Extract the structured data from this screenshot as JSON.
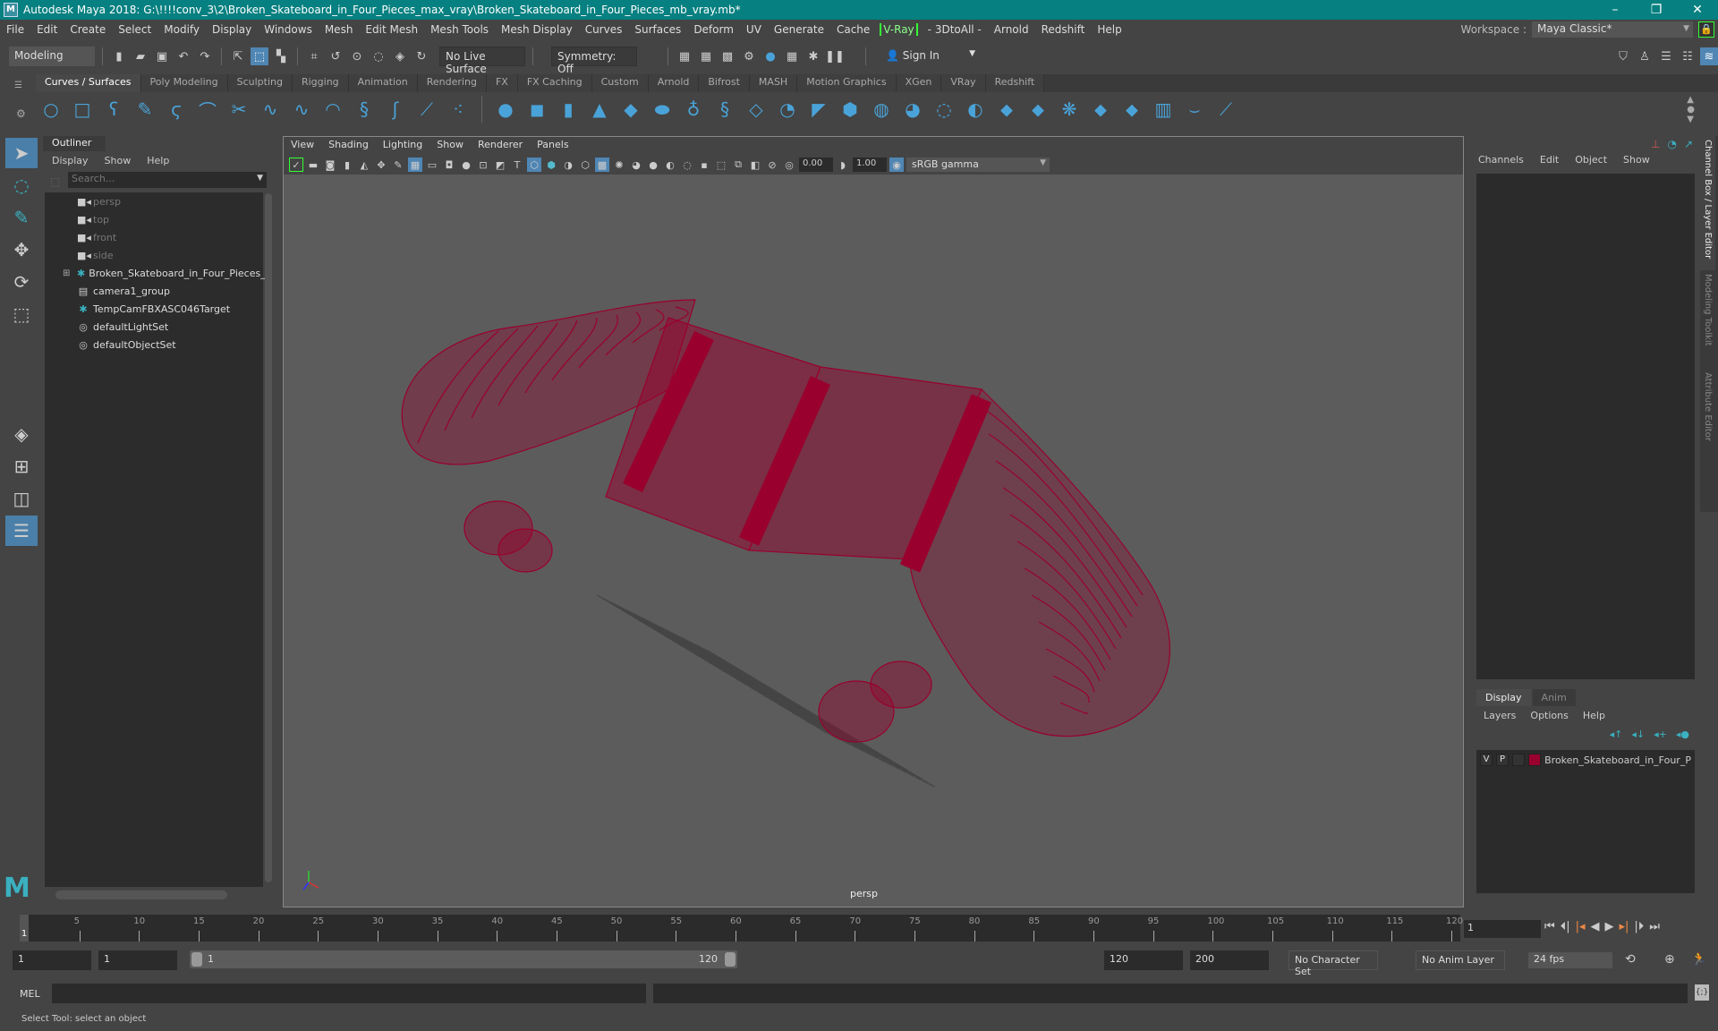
{
  "window": {
    "title": "Autodesk Maya 2018: G:\\!!!!conv_3\\2\\Broken_Skateboard_in_Four_Pieces_max_vray\\Broken_Skateboard_in_Four_Pieces_mb_vray.mb*",
    "controls": [
      "–",
      "❐",
      "✕"
    ]
  },
  "menubar": [
    "File",
    "Edit",
    "Create",
    "Select",
    "Modify",
    "Display",
    "Windows",
    "Mesh",
    "Edit Mesh",
    "Mesh Tools",
    "Mesh Display",
    "Curves",
    "Surfaces",
    "Deform",
    "UV",
    "Generate",
    "Cache",
    "V-Ray",
    "- 3DtoAll -",
    "Arnold",
    "Redshift",
    "Help"
  ],
  "workspace": {
    "label": "Workspace :",
    "value": "Maya Classic*"
  },
  "statusline": {
    "mode": "Modeling",
    "live_surface": "No Live Surface",
    "symmetry": "Symmetry: Off",
    "sign_in": "Sign In"
  },
  "shelf": {
    "tabs": [
      "Curves / Surfaces",
      "Poly Modeling",
      "Sculpting",
      "Rigging",
      "Animation",
      "Rendering",
      "FX",
      "FX Caching",
      "Custom",
      "Arnold",
      "Bifrost",
      "MASH",
      "Motion Graphics",
      "XGen",
      "VRay",
      "Redshift"
    ],
    "active_tab": 0
  },
  "outliner": {
    "title": "Outliner",
    "menu": [
      "Display",
      "Show",
      "Help"
    ],
    "search_placeholder": "Search...",
    "items": [
      {
        "label": "persp",
        "icon": "camera-icon",
        "dim": true
      },
      {
        "label": "top",
        "icon": "camera-icon",
        "dim": true
      },
      {
        "label": "front",
        "icon": "camera-icon",
        "dim": true
      },
      {
        "label": "side",
        "icon": "camera-icon",
        "dim": true
      },
      {
        "label": "Broken_Skateboard_in_Four_Pieces_r",
        "icon": "transform-icon",
        "expandable": true
      },
      {
        "label": "camera1_group",
        "icon": "group-icon"
      },
      {
        "label": "TempCamFBXASC046Target",
        "icon": "transform-icon"
      },
      {
        "label": "defaultLightSet",
        "icon": "set-icon"
      },
      {
        "label": "defaultObjectSet",
        "icon": "set-icon"
      }
    ]
  },
  "viewport": {
    "menu": [
      "View",
      "Shading",
      "Lighting",
      "Show",
      "Renderer",
      "Panels"
    ],
    "exposure": "0.00",
    "gamma": "1.00",
    "color_space": "sRGB gamma",
    "camera": "persp",
    "wire_color": "#99002e"
  },
  "channelbox": {
    "menu": [
      "Channels",
      "Edit",
      "Object",
      "Show"
    ]
  },
  "side_tabs": [
    "Channel Box / Layer Editor",
    "Modeling Toolkit",
    "Attribute Editor"
  ],
  "layers": {
    "tabs": [
      "Display",
      "Anim"
    ],
    "menu": [
      "Layers",
      "Options",
      "Help"
    ],
    "rows": [
      {
        "v": "V",
        "p": "P",
        "color": "#99002e",
        "name": "Broken_Skateboard_in_Four_P"
      }
    ]
  },
  "timeline": {
    "ticks": [
      5,
      10,
      15,
      20,
      25,
      30,
      35,
      40,
      45,
      50,
      55,
      60,
      65,
      70,
      75,
      80,
      85,
      90,
      95,
      100,
      105,
      110,
      115,
      120
    ],
    "current": "1",
    "current_field": "1"
  },
  "range": {
    "start": "1",
    "anim_start": "1",
    "slider_start": "1",
    "slider_end": "120",
    "anim_end": "120",
    "end": "200",
    "character_set": "No Character Set",
    "anim_layer": "No Anim Layer",
    "fps": "24 fps"
  },
  "cmdline": {
    "label": "MEL"
  },
  "help_line": "Select Tool: select an object"
}
